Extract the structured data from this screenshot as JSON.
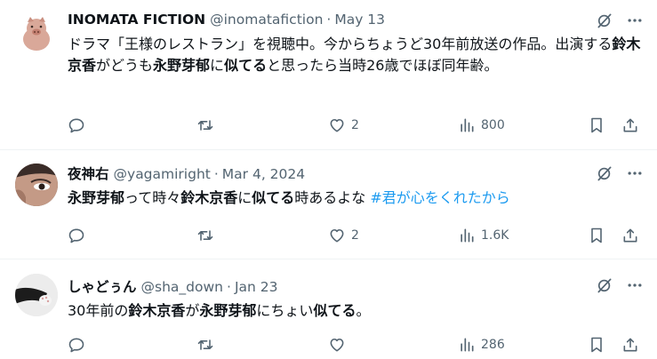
{
  "tweets": [
    {
      "name": "INOMATA FICTION",
      "handle": "@inomatafiction",
      "separator": "·",
      "date": "May 13",
      "body": [
        {
          "t": "ドラマ「王様のレストラン」を視聴中。今からちょうど30年前放送の作品。出演する",
          "s": "n"
        },
        {
          "t": "鈴木京香",
          "s": "b"
        },
        {
          "t": "がどうも",
          "s": "n"
        },
        {
          "t": "永野芽郁",
          "s": "b"
        },
        {
          "t": "に",
          "s": "n"
        },
        {
          "t": "似てる",
          "s": "b"
        },
        {
          "t": "と思ったら当時26歳でほぼ同年齢。",
          "s": "n"
        }
      ],
      "reply_count": "",
      "retweet_count": "",
      "like_count": "2",
      "view_count": "800"
    },
    {
      "name": "夜神右",
      "handle": "@yagamiright",
      "separator": "·",
      "date": "Mar 4, 2024",
      "body": [
        {
          "t": "永野芽郁",
          "s": "b"
        },
        {
          "t": "って時々",
          "s": "n"
        },
        {
          "t": "鈴木京香",
          "s": "b"
        },
        {
          "t": "に",
          "s": "n"
        },
        {
          "t": "似てる",
          "s": "b"
        },
        {
          "t": "時あるよな ",
          "s": "n"
        },
        {
          "t": "#君が心をくれたから",
          "s": "h"
        }
      ],
      "reply_count": "",
      "retweet_count": "",
      "like_count": "2",
      "view_count": "1.6K"
    },
    {
      "name": "しゃどぅん",
      "handle": "@sha_down",
      "separator": "·",
      "date": "Jan 23",
      "body": [
        {
          "t": "30年前の",
          "s": "n"
        },
        {
          "t": "鈴木京香",
          "s": "b"
        },
        {
          "t": "が",
          "s": "n"
        },
        {
          "t": "永野芽郁",
          "s": "b"
        },
        {
          "t": "にちょい",
          "s": "n"
        },
        {
          "t": "似てる",
          "s": "b"
        },
        {
          "t": "。",
          "s": "n"
        }
      ],
      "reply_count": "",
      "retweet_count": "",
      "like_count": "",
      "view_count": "286"
    }
  ],
  "icons": {
    "grok": "grok-slash-icon",
    "more": "more-dots-icon",
    "reply": "reply-icon",
    "retweet": "retweet-icon",
    "like": "heart-icon",
    "views": "views-bar-icon",
    "bookmark": "bookmark-icon",
    "share": "share-icon"
  },
  "colors": {
    "text": "#0f1419",
    "muted": "#536471",
    "hashtag": "#1d9bf0",
    "divider": "#eff3f4"
  }
}
